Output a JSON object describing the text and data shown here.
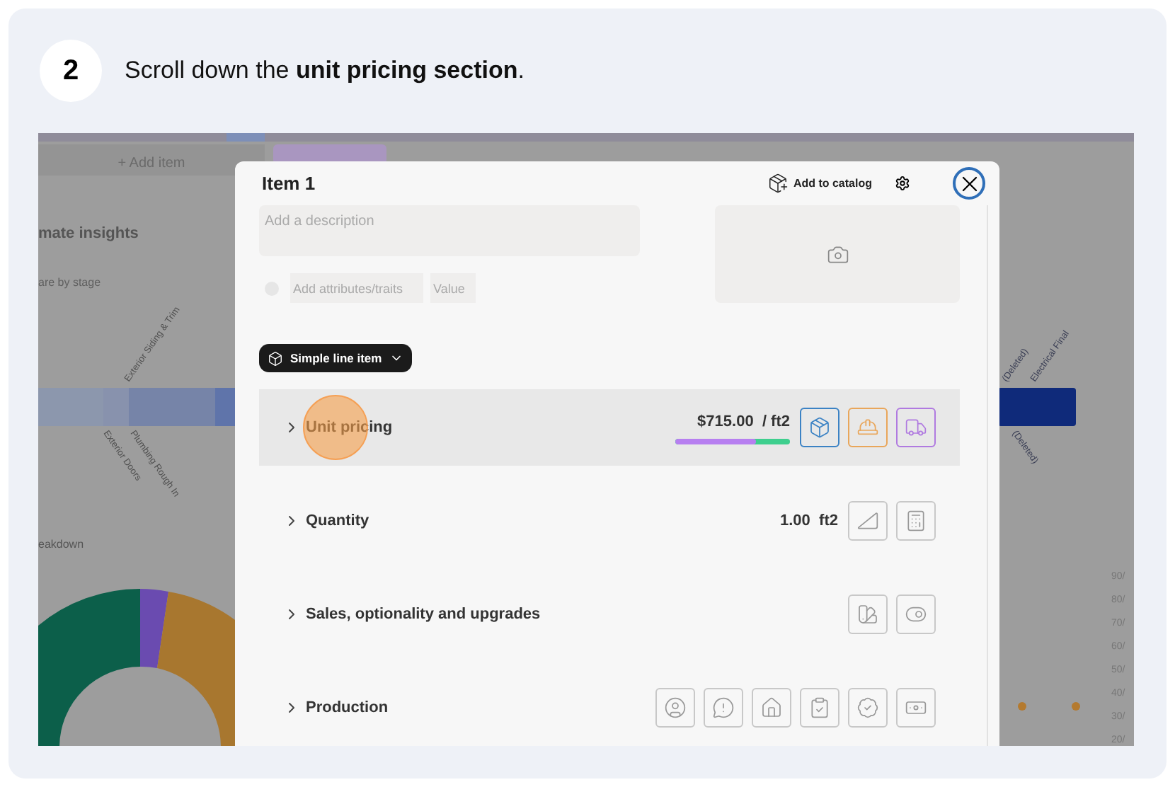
{
  "step": {
    "number": "2",
    "instruction": "Scroll down the **unit pricing section**."
  },
  "background": {
    "add_item": "+ Add item",
    "insights_title": "mate insights",
    "stage_subtitle": "are by stage",
    "stage_labels": [
      "Exterior Siding & Trim",
      "Exterior Doors",
      "Plumbing Rough In",
      "(Deleted)",
      "Electrical Final",
      "(Deleted)"
    ],
    "breakdown_title": "eakdown",
    "axis_labels": [
      "90/",
      "80/",
      "70/",
      "60/",
      "50/",
      "40/",
      "30/",
      "20/"
    ]
  },
  "modal": {
    "title": "Item 1",
    "add_to_catalog": "Add to catalog",
    "description": {
      "placeholder": "Add a description"
    },
    "attribute": {
      "placeholder": "Add attributes/traits"
    },
    "value": {
      "placeholder": "Value"
    },
    "item_type": "Simple line item",
    "sections": [
      {
        "label": "Unit pricing",
        "selected": true,
        "value": "$715.00",
        "unit": "/ ft2",
        "level": 0.7,
        "buttons": [
          {
            "color": "#3b82c4"
          },
          {
            "color": "#e9a65a"
          },
          {
            "color": "#b07ae0"
          }
        ]
      },
      {
        "label": "Quantity",
        "selected": false,
        "value": "1.00",
        "unit": "ft2",
        "buttons": [
          {
            "color": "#c8c8c8"
          },
          {
            "color": "#c8c8c8"
          }
        ]
      },
      {
        "label": "Sales, optionality and upgrades",
        "selected": false,
        "buttons": [
          {
            "color": "#c8c8c8"
          },
          {
            "color": "#c8c8c8"
          }
        ]
      },
      {
        "label": "Production",
        "selected": false,
        "buttons": [
          {
            "color": "#c8c8c8"
          },
          {
            "color": "#c8c8c8"
          },
          {
            "color": "#c8c8c8"
          },
          {
            "color": "#c8c8c8"
          },
          {
            "color": "#c8c8c8"
          },
          {
            "color": "#c8c8c8"
          }
        ]
      }
    ]
  }
}
